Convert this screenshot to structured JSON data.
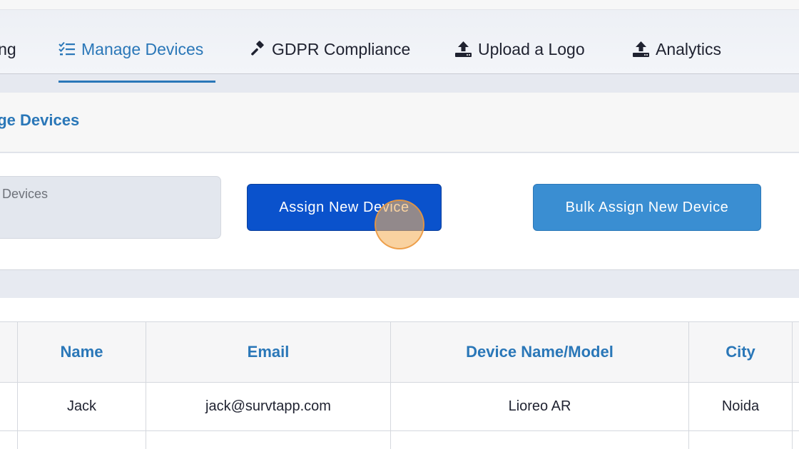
{
  "tabs": {
    "items": [
      {
        "label": "ing",
        "icon": "truncated"
      },
      {
        "label": "Manage Devices",
        "icon": "checklist-icon",
        "active": true
      },
      {
        "label": "GDPR Compliance",
        "icon": "gavel-icon"
      },
      {
        "label": "Upload a Logo",
        "icon": "upload-icon"
      },
      {
        "label": "Analytics",
        "icon": "upload-icon"
      }
    ],
    "active_color": "#2a77b8"
  },
  "section": {
    "title": "age Devices"
  },
  "actions": {
    "search_text": "ed Devices",
    "assign_button": "Assign New Device",
    "bulk_assign_button": "Bulk Assign New Device",
    "assign_color": "#0a52cc",
    "bulk_color": "#3a8ed2"
  },
  "table": {
    "columns": [
      "Name",
      "Email",
      "Device Name/Model",
      "City"
    ],
    "rows": [
      {
        "name": "Jack",
        "email": "jack@survtapp.com",
        "device": "Lioreo AR",
        "city": "Noida"
      }
    ]
  }
}
